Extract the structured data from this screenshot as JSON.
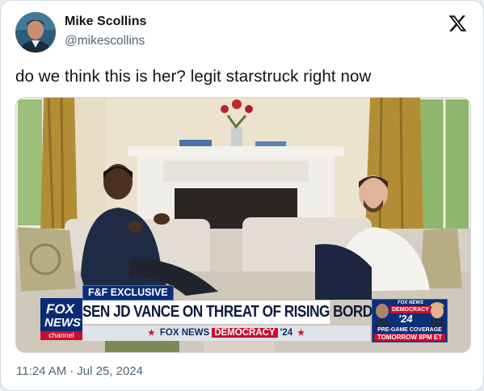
{
  "author": {
    "display_name": "Mike Scollins",
    "handle": "@mikescollins"
  },
  "tweet": {
    "text": "do we think this is her? legit starstruck right now",
    "time": "11:24 AM",
    "separator": "·",
    "date": "Jul 25, 2024"
  },
  "media": {
    "chyron": {
      "tag": "F&F EXCLUSIVE",
      "headline": "SEN JD VANCE ON THREAT OF RISING BORDER CRISIS",
      "ticker_network": "FOX NEWS",
      "ticker_democracy": "DEMOCRACY",
      "ticker_year": "'24"
    },
    "network_logo": {
      "line1": "FOX",
      "line2": "NEWS",
      "line3": "channel"
    },
    "promo": {
      "brand": "FOX NEWS",
      "democracy": "DEMOCRACY",
      "year": "'24",
      "pre_game": "PRE-GAME COVERAGE",
      "time": "TOMORROW 8PM ET"
    }
  },
  "icons": {
    "platform": "x-logo-icon"
  },
  "colors": {
    "text_primary": "#0f1419",
    "text_secondary": "#536471",
    "fox_blue": "#0a2a73",
    "fox_red": "#c8102e"
  }
}
